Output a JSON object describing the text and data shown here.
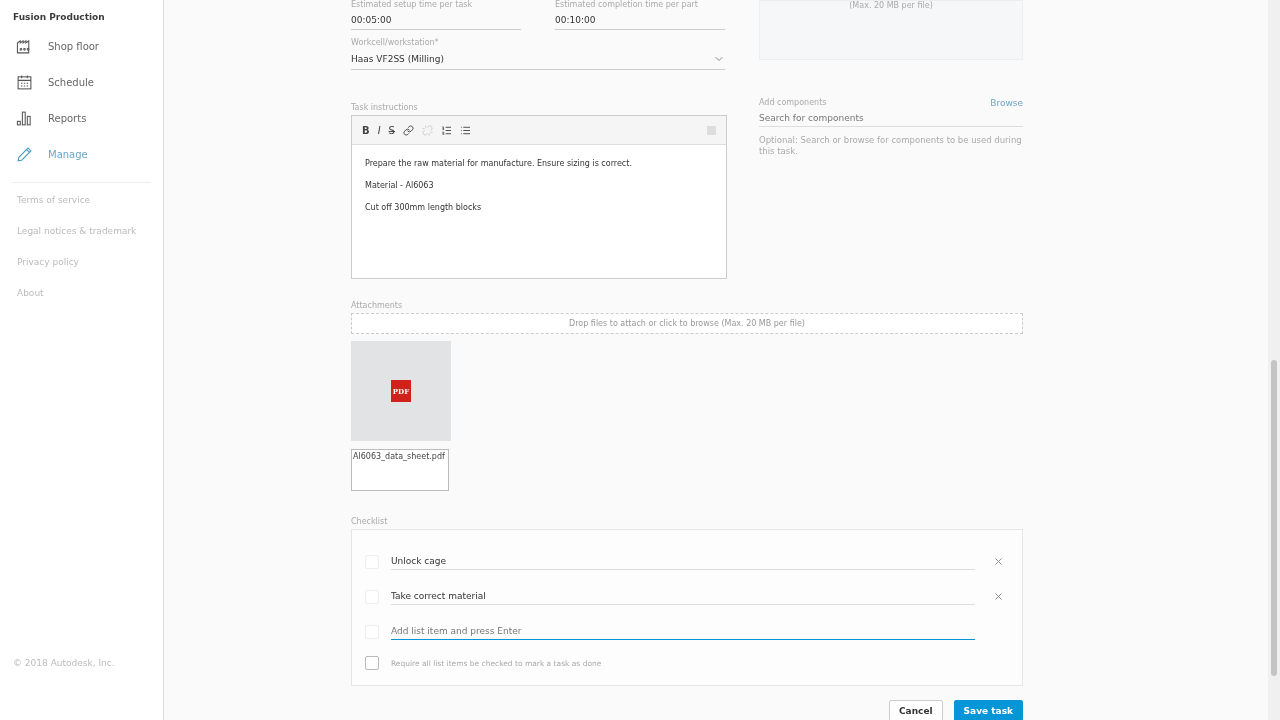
{
  "sidebar": {
    "title": "Fusion Production",
    "nav": [
      {
        "label": "Shop floor",
        "selected": false
      },
      {
        "label": "Schedule",
        "selected": false
      },
      {
        "label": "Reports",
        "selected": false
      },
      {
        "label": "Manage",
        "selected": true
      }
    ],
    "links": [
      "Terms of service",
      "Legal notices & trademark",
      "Privacy policy",
      "About"
    ],
    "copyright": "© 2018 Autodesk, Inc."
  },
  "form": {
    "times": [
      {
        "label": "Estimated setup time per task",
        "value": "00:05:00"
      },
      {
        "label": "Estimated completion time per part",
        "value": "00:10:00"
      }
    ],
    "workcell": {
      "label": "Workcell/workstation*",
      "value": "Haas VF2SS (Milling)"
    },
    "upload_note": "(Max. 20 MB per file)",
    "instructions": {
      "label": "Task instructions",
      "toolbar": [
        {
          "kind": "text",
          "label": "B"
        },
        {
          "kind": "text",
          "label": "I"
        },
        {
          "kind": "text",
          "label": "S"
        },
        {
          "kind": "link",
          "disabled": false
        },
        {
          "kind": "unlink",
          "disabled": true
        },
        {
          "kind": "ordered"
        },
        {
          "kind": "bullets"
        }
      ],
      "paragraphs": [
        "Prepare the raw material for manufacture. Ensure sizing is correct.",
        "Material - Al6063",
        "Cut off 300mm length blocks"
      ]
    },
    "components": {
      "label": "Add components",
      "browse": "Browse",
      "placeholder": "Search for components",
      "hint": "Optional: Search or browse for components to be used during this task."
    },
    "attachments": {
      "label": "Attachments",
      "drop": "Drop files to attach or click to browse (Max. 20 MB per file)",
      "files": [
        {
          "badge": "PDF",
          "name": "Al6063_data_sheet.pdf"
        }
      ]
    },
    "checklist": {
      "label": "Checklist",
      "items": [
        {
          "kind": "item",
          "checked": false,
          "value": "Unlock cage"
        },
        {
          "kind": "item",
          "checked": false,
          "value": "Take correct material"
        },
        {
          "kind": "new",
          "checked": false,
          "placeholder": "Add list item and press Enter"
        }
      ],
      "require": {
        "checked": false,
        "label": "Require all list items be checked to mark a task as done"
      }
    },
    "buttons": [
      {
        "label": "Cancel",
        "kind": "secondary"
      },
      {
        "label": "Save task",
        "kind": "primary"
      }
    ]
  }
}
